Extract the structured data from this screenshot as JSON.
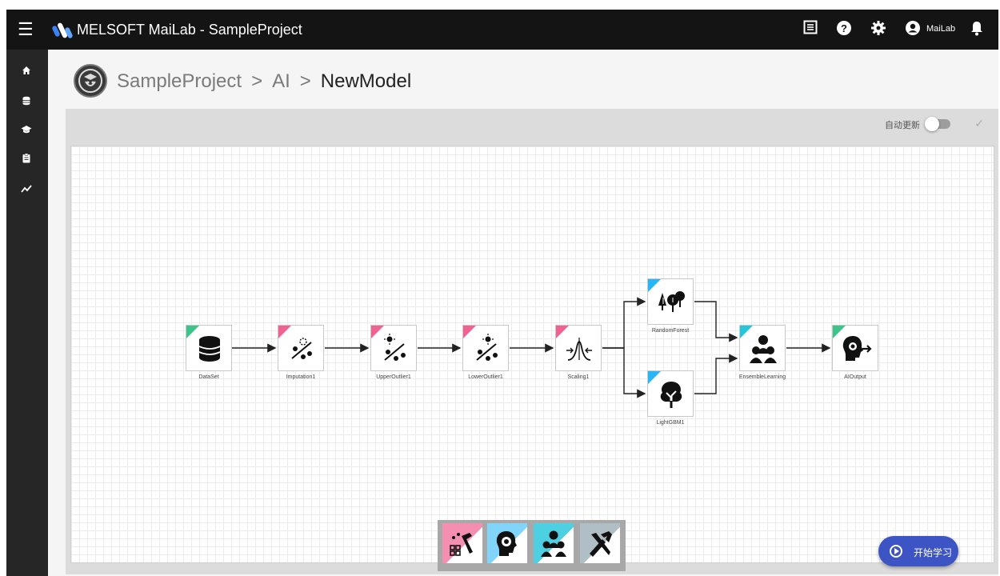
{
  "app": {
    "title": "MELSOFT MaiLab - SampleProject",
    "user": "MaiLab"
  },
  "topbar": {
    "icons": [
      "list-icon",
      "help-icon",
      "gear-icon",
      "account-icon",
      "bell-icon"
    ]
  },
  "sidebar": {
    "items": [
      {
        "icon": "home-icon"
      },
      {
        "icon": "database-icon"
      },
      {
        "icon": "graduation-cap-icon"
      },
      {
        "icon": "clipboard-icon"
      },
      {
        "icon": "trend-chart-icon"
      }
    ]
  },
  "breadcrumb": {
    "items": [
      "SampleProject",
      "AI",
      "NewModel"
    ],
    "separator": ">"
  },
  "toolbar": {
    "auto_update_label": "自动更新",
    "auto_update_on": false
  },
  "nodes": [
    {
      "label": "DataSet",
      "icon": "database-icon",
      "tag_color": "#3cc48a"
    },
    {
      "label": "Imputation1",
      "icon": "imputation-icon",
      "tag_color": "#f06292"
    },
    {
      "label": "UpperOutlier1",
      "icon": "upper-outlier-icon",
      "tag_color": "#f06292"
    },
    {
      "label": "LowerOutlier1",
      "icon": "lower-outlier-icon",
      "tag_color": "#f06292"
    },
    {
      "label": "Scaling1",
      "icon": "scaling-icon",
      "tag_color": "#f06292"
    },
    {
      "label": "RandomForest",
      "icon": "random-forest-icon",
      "tag_color": "#29b6f6"
    },
    {
      "label": "LightGBM1",
      "icon": "tree-icon",
      "tag_color": "#29b6f6"
    },
    {
      "label": "EnsembleLearning",
      "icon": "ensemble-icon",
      "tag_color": "#26c6da"
    },
    {
      "label": "AIOutput",
      "icon": "ai-output-icon",
      "tag_color": "#3cc48a"
    }
  ],
  "palette": {
    "items": [
      {
        "icon": "preprocess-tools-icon",
        "color": "#f48fb1"
      },
      {
        "icon": "ai-model-icon",
        "color": "#81d4fa"
      },
      {
        "icon": "ensemble-icon",
        "color": "#4dd0e1"
      },
      {
        "icon": "utility-tools-icon",
        "color": "#b0bec5"
      }
    ]
  },
  "actions": {
    "start_learning_label": "开始学习"
  }
}
